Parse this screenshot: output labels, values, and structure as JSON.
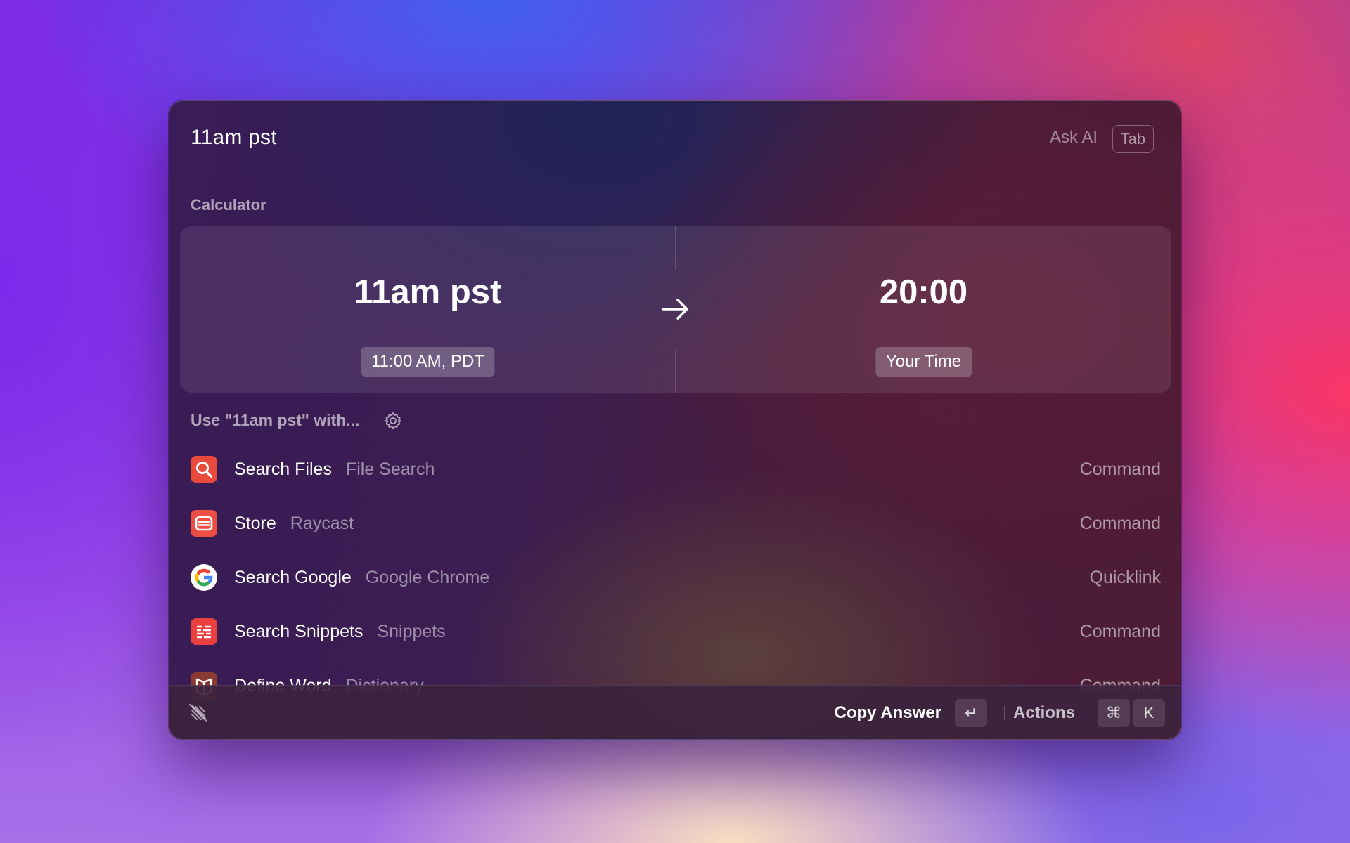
{
  "search": {
    "query": "11am pst",
    "ask_ai_label": "Ask AI",
    "ask_ai_key": "Tab"
  },
  "calculator": {
    "section_title": "Calculator",
    "input": "11am pst",
    "input_detail": "11:00 AM, PDT",
    "result": "20:00",
    "result_detail": "Your Time"
  },
  "use_with": {
    "label": "Use \"11am pst\" with..."
  },
  "results": [
    {
      "title": "Search Files",
      "subtitle": "File Search",
      "kind": "Command",
      "icon": "magnifier-icon",
      "color": "#e94a3c"
    },
    {
      "title": "Store",
      "subtitle": "Raycast",
      "kind": "Command",
      "icon": "store-icon",
      "color": "#ec4e44"
    },
    {
      "title": "Search Google",
      "subtitle": "Google Chrome",
      "kind": "Quicklink",
      "icon": "google-icon",
      "color": "#ffffff"
    },
    {
      "title": "Search Snippets",
      "subtitle": "Snippets",
      "kind": "Command",
      "icon": "snippets-icon",
      "color": "#ea4040"
    },
    {
      "title": "Define Word",
      "subtitle": "Dictionary",
      "kind": "Command",
      "icon": "dictionary-icon",
      "color": "#8a3a32"
    }
  ],
  "footer": {
    "primary_action": "Copy Answer",
    "primary_key": "↵",
    "actions_label": "Actions",
    "actions_keys": [
      "⌘",
      "K"
    ]
  }
}
